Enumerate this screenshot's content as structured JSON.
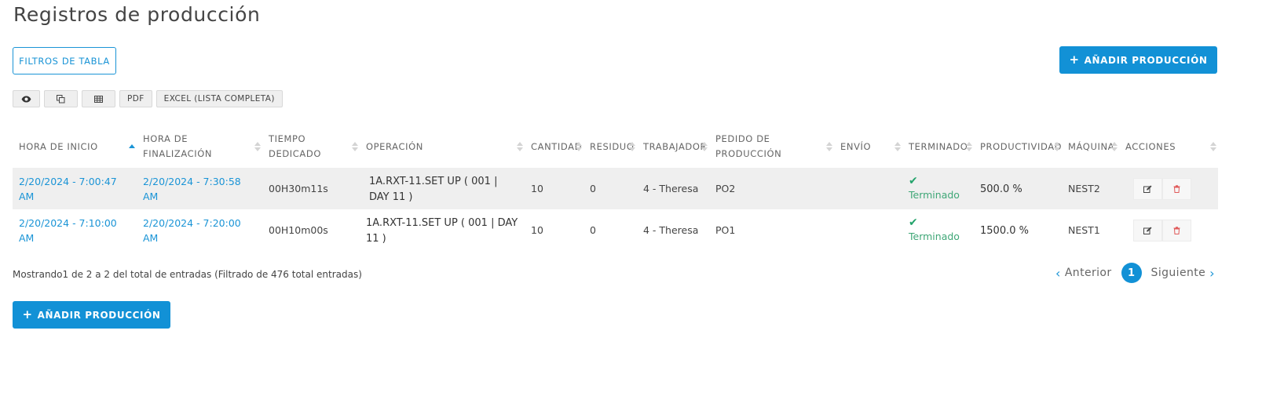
{
  "page": {
    "title": "Registros de producción"
  },
  "toolbar": {
    "filters_label": "FILTROS DE TABLA",
    "add_label": "AÑADIR PRODUCCIÓN",
    "plus_icon": "plus-icon"
  },
  "export_buttons": {
    "visibility_icon": "eye-icon",
    "copy_icon": "copy-icon",
    "csv_icon": "table-icon",
    "pdf_label": "PDF",
    "excel_label": "EXCEL (LISTA COMPLETA)"
  },
  "table": {
    "columns": [
      "HORA DE INICIO",
      "HORA DE FINALIZACIÓN",
      "TIEMPO DEDICADO",
      "OPERACIÓN",
      "CANTIDAD",
      "RESIDUO",
      "TRABAJADOR",
      "PEDIDO DE PRODUCCIÓN",
      "ENVÍO",
      "TERMINADO",
      "PRODUCTIVIDAD",
      "MÁQUINA",
      "ACCIONES"
    ],
    "sorted_column": "HORA DE INICIO",
    "sort_direction": "ascending",
    "rows": [
      {
        "start": "2/20/2024 - 7:00:47 AM",
        "end": "2/20/2024 - 7:30:58 AM",
        "time": "00H30m11s",
        "operation": "1A.RXT-11.SET UP ( 001 | DAY 11 )",
        "quantity": "10",
        "waste": "0",
        "worker": "4 - Theresa",
        "order": "PO2",
        "shipment": "",
        "finished": "Terminado",
        "productivity": "500.0 %",
        "machine": "NEST2"
      },
      {
        "start": "2/20/2024 - 7:10:00 AM",
        "end": "2/20/2024 - 7:20:00 AM",
        "time": "00H10m00s",
        "operation": "1A.RXT-11.SET UP ( 001 | DAY 11 )",
        "quantity": "10",
        "waste": "0",
        "worker": "4 - Theresa",
        "order": "PO1",
        "shipment": "",
        "finished": "Terminado",
        "productivity": "1500.0 %",
        "machine": "NEST1"
      }
    ],
    "action_icons": [
      "edit-icon",
      "trash-icon"
    ]
  },
  "footer": {
    "info": "Mostrando1 de 2 a 2 del total de entradas (Filtrado de 476 total entradas)"
  },
  "pagination": {
    "prev_label": "Anterior",
    "next_label": "Siguiente",
    "current_page": "1"
  },
  "colors": {
    "accent": "#1291d6",
    "success": "#23a36b",
    "danger": "#e05a5a",
    "row_shade": "#efefef"
  }
}
